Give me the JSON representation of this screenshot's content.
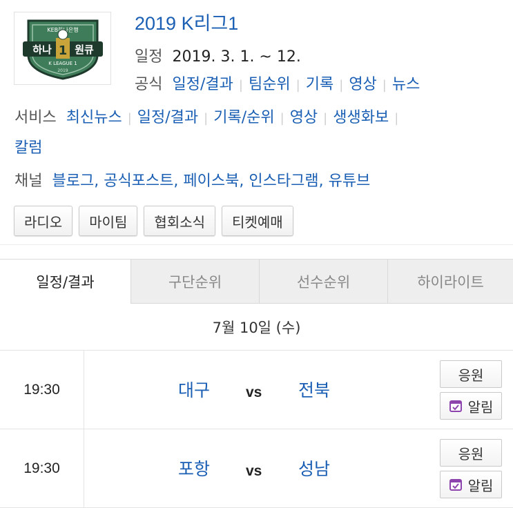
{
  "logo": {
    "top_text": "KEB하나은행",
    "main_text_left": "하나",
    "main_text_num": "1",
    "main_text_right": "원큐",
    "league_text": "K LEAGUE 1",
    "year_text": "2019",
    "colors": {
      "green": "#3f7d5a",
      "dark": "#1e3a2c",
      "gold": "#c9a43a"
    }
  },
  "header": {
    "title": "2019 K리그1",
    "schedule_label": "일정",
    "schedule_value": "2019. 3. 1. ~ 12.",
    "official_label": "공식",
    "official_links": [
      "일정/결과",
      "팀순위",
      "기록",
      "영상",
      "뉴스"
    ]
  },
  "services": {
    "label": "서비스",
    "links": [
      "최신뉴스",
      "일정/결과",
      "기록/순위",
      "영상",
      "생생화보"
    ],
    "links_line2": [
      "칼럼"
    ]
  },
  "channels": {
    "label": "채널",
    "links": [
      "블로그,",
      "공식포스트,",
      "페이스북,",
      "인스타그램,",
      "유튜브"
    ]
  },
  "buttons": [
    "라디오",
    "마이팀",
    "협회소식",
    "티켓예매"
  ],
  "tabs": [
    "일정/결과",
    "구단순위",
    "선수순위",
    "하이라이트"
  ],
  "date": "7월 10일 (수)",
  "matches": [
    {
      "time": "19:30",
      "home": "대구",
      "vs": "vs",
      "away": "전북",
      "cheer": "응원",
      "alarm": "알림"
    },
    {
      "time": "19:30",
      "home": "포항",
      "vs": "vs",
      "away": "성남",
      "cheer": "응원",
      "alarm": "알림"
    }
  ],
  "colors": {
    "link": "#1a5fb4",
    "tab_inactive_bg": "#eeeeee",
    "calendar_icon": "#8e44ad"
  }
}
